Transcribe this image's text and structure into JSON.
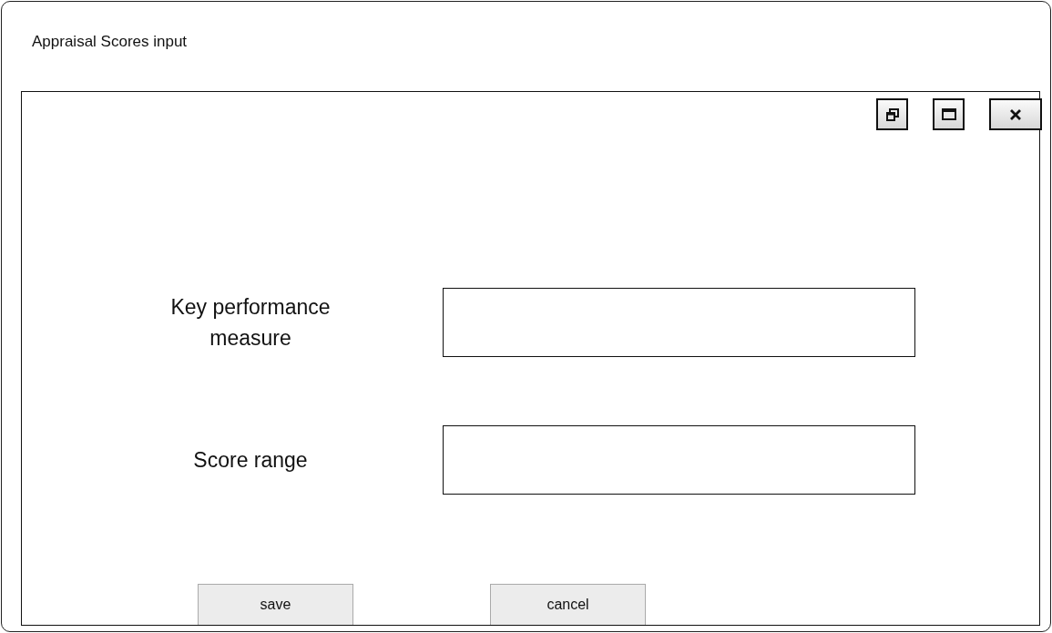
{
  "window": {
    "title": "Appraisal Scores input"
  },
  "window_controls": [
    {
      "kind": "restore"
    },
    {
      "kind": "maximize"
    },
    {
      "kind": "close"
    }
  ],
  "fields": [
    {
      "label": "Key performance measure"
    },
    {
      "label": "Score range"
    }
  ],
  "buttons": [
    "save",
    "cancel"
  ]
}
